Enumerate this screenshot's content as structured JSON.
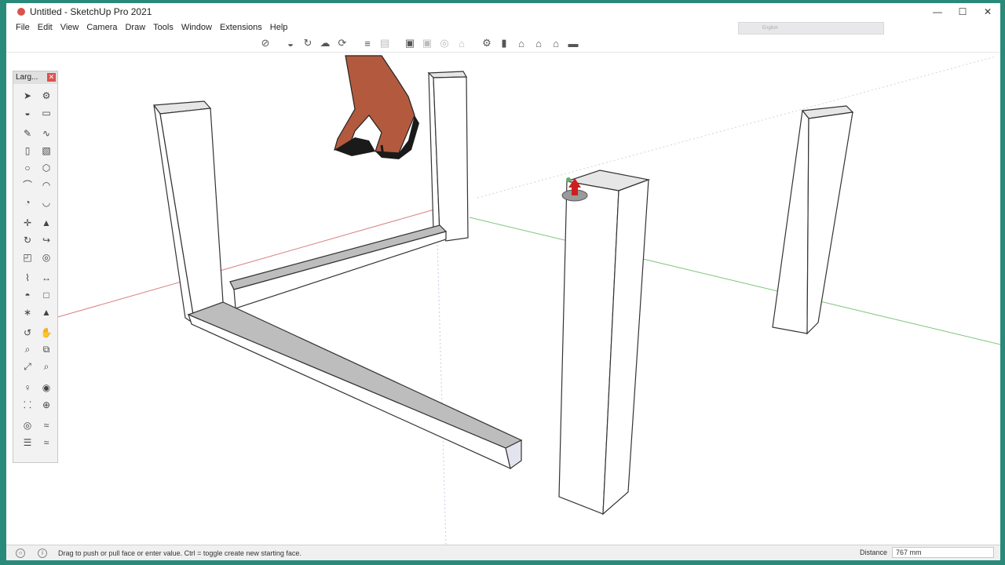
{
  "window": {
    "title": "Untitled - SketchUp Pro 2021",
    "minimize": "—",
    "maximize": "☐",
    "close": "✕"
  },
  "menu": [
    "File",
    "Edit",
    "View",
    "Camera",
    "Draw",
    "Tools",
    "Window",
    "Extensions",
    "Help"
  ],
  "language_bar": {
    "label": "English"
  },
  "toolbar": {
    "icons": [
      "select-icon",
      "paint-icon",
      "orbit-icon",
      "pan-icon",
      "rotate-icon",
      "section-icon",
      "section-fill-icon",
      "view-iso-icon",
      "view-top-icon",
      "view-front-icon",
      "view-lock-icon",
      "components-icon",
      "materials-icon",
      "house-icon",
      "house-alt-icon",
      "house-outline-icon",
      "warehouse-icon"
    ]
  },
  "tool_palette": {
    "title": "Larg...",
    "close": "✕",
    "tools": [
      "select-icon",
      "component-icon",
      "paint-bucket-icon",
      "eraser-icon",
      "pencil-icon",
      "freehand-icon",
      "rectangle-icon",
      "rotated-rect-icon",
      "circle-icon",
      "polygon-icon",
      "arc-icon",
      "arc-2pt-icon",
      "pie-icon",
      "arc-3pt-icon",
      "move-icon",
      "push-pull-icon",
      "rotate-icon",
      "follow-me-icon",
      "scale-icon",
      "offset-icon",
      "tape-measure-icon",
      "dimension-icon",
      "protractor-icon",
      "text-icon",
      "axes-icon",
      "3d-text-icon",
      "orbit-icon",
      "pan-icon",
      "zoom-icon",
      "zoom-window-icon",
      "zoom-extents-icon",
      "previous-view-icon",
      "position-camera-icon",
      "look-around-icon",
      "walk-icon",
      "section-plane-icon",
      "sandbox-icon",
      "sandbox-2-icon",
      "layers-icon",
      "layers-2-icon"
    ]
  },
  "status": {
    "message": "Drag to push or pull face or enter value.  Ctrl = toggle create new starting face.",
    "measure_label": "Distance",
    "measure_value": "767 mm"
  },
  "colors": {
    "axis_red": "#d98080",
    "axis_green": "#7cc47c",
    "face": "#ffffff",
    "face_shade": "#e8e8e8",
    "push_pull_arrow": "#cc2020"
  }
}
